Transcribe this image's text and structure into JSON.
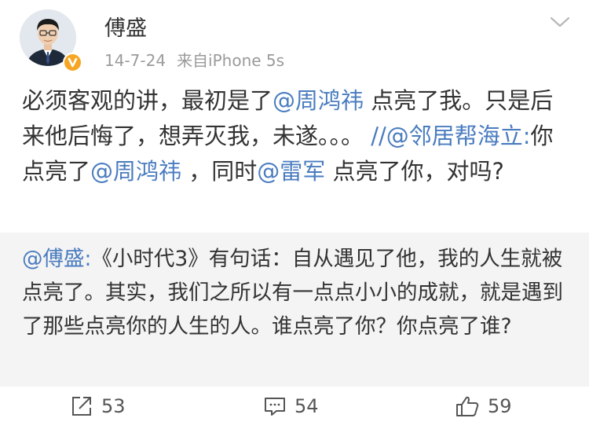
{
  "post": {
    "author": "傅盛",
    "date": "14-7-24",
    "source": "来自iPhone 5s",
    "body": {
      "p1": "必须客观的讲，最初是了",
      "mention1": "@周鸿祎",
      "p2": " 点亮了我。只是后来他后悔了，想弄灭我，未遂。。。 ",
      "mention2": "//@邻居帮海立:",
      "p3": "你点亮了",
      "mention3": "@周鸿祎",
      "p4": " ，同时",
      "mention4": "@雷军",
      "p5": " 点亮了你，对吗?"
    }
  },
  "repost": {
    "mention": "@傅盛:",
    "text": "《小时代3》有句话：自从遇见了他，我的人生就被点亮了。其实，我们之所以有一点点小小的成就，就是遇到了那些点亮你的人生的人。谁点亮了你？你点亮了谁?"
  },
  "actions": {
    "repost_count": "53",
    "comment_count": "54",
    "like_count": "59"
  },
  "colors": {
    "link": "#4a7cbf",
    "verified_badge": "#f6a623",
    "repost_bg": "#f4f4f4"
  },
  "icons": [
    "avatar",
    "verified-badge-icon",
    "chevron-down-icon",
    "repost-icon",
    "comment-icon",
    "like-icon"
  ]
}
